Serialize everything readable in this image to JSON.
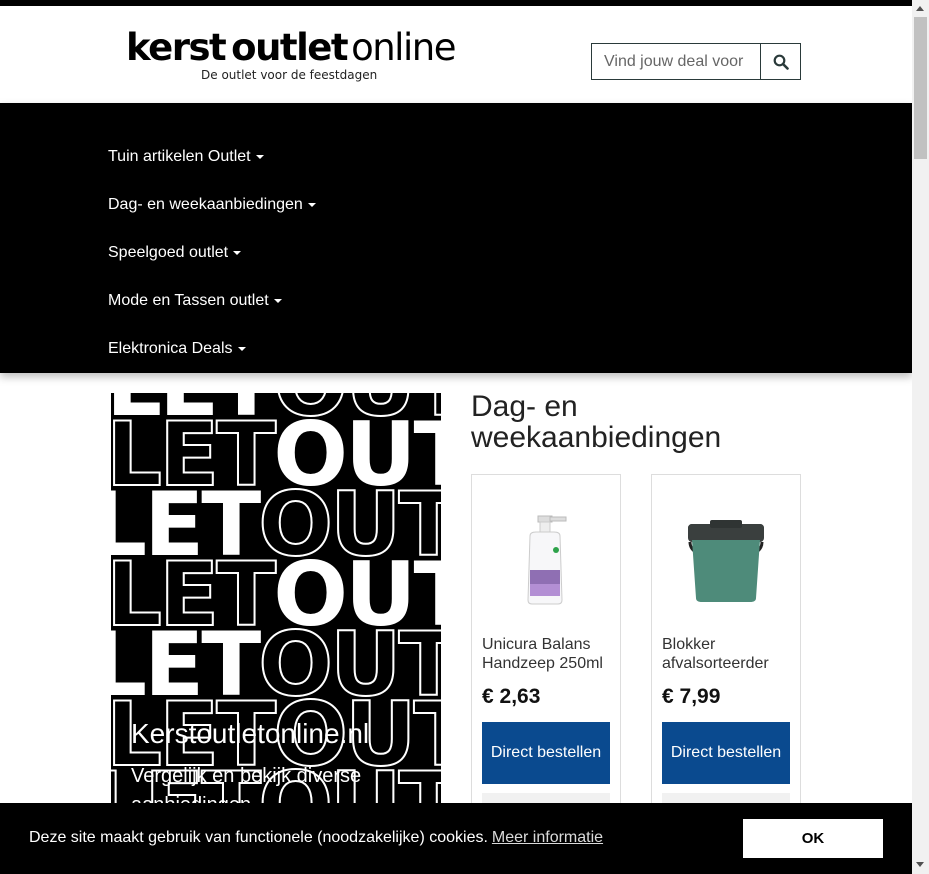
{
  "header": {
    "logo_part1": "kerst",
    "logo_part2": "outlet",
    "logo_part3": "online",
    "logo_tagline": "De outlet voor de feestdagen",
    "search_placeholder": "Vind jouw deal voor",
    "search_icon": "search-icon"
  },
  "nav": {
    "items": [
      {
        "label": "Tuin artikelen Outlet"
      },
      {
        "label": "Dag- en weekaanbiedingen"
      },
      {
        "label": "Speelgoed outlet"
      },
      {
        "label": "Mode en Tassen outlet"
      },
      {
        "label": "Elektronica Deals"
      }
    ]
  },
  "hero": {
    "bg_words": [
      "OUT",
      "LET"
    ],
    "title": "Kerstoutletonline.nl",
    "subtitle": "Vergelijk en bekijk diverse aanbiedingen"
  },
  "section": {
    "title": "Dag- en weekaanbiedingen"
  },
  "products": [
    {
      "name": "Unicura Balans Handzeep 250ml",
      "price": "€ 2,63",
      "button": "Direct bestellen"
    },
    {
      "name": "Blokker afvalsorteerder",
      "price": "€ 7,99",
      "button": "Direct bestellen"
    }
  ],
  "cookie": {
    "text": "Deze site maakt gebruik van functionele (noodzakelijke) cookies.",
    "link": "Meer informatie",
    "ok": "OK"
  },
  "colors": {
    "button_blue": "#0a4a8f",
    "nav_bg": "#000000"
  }
}
